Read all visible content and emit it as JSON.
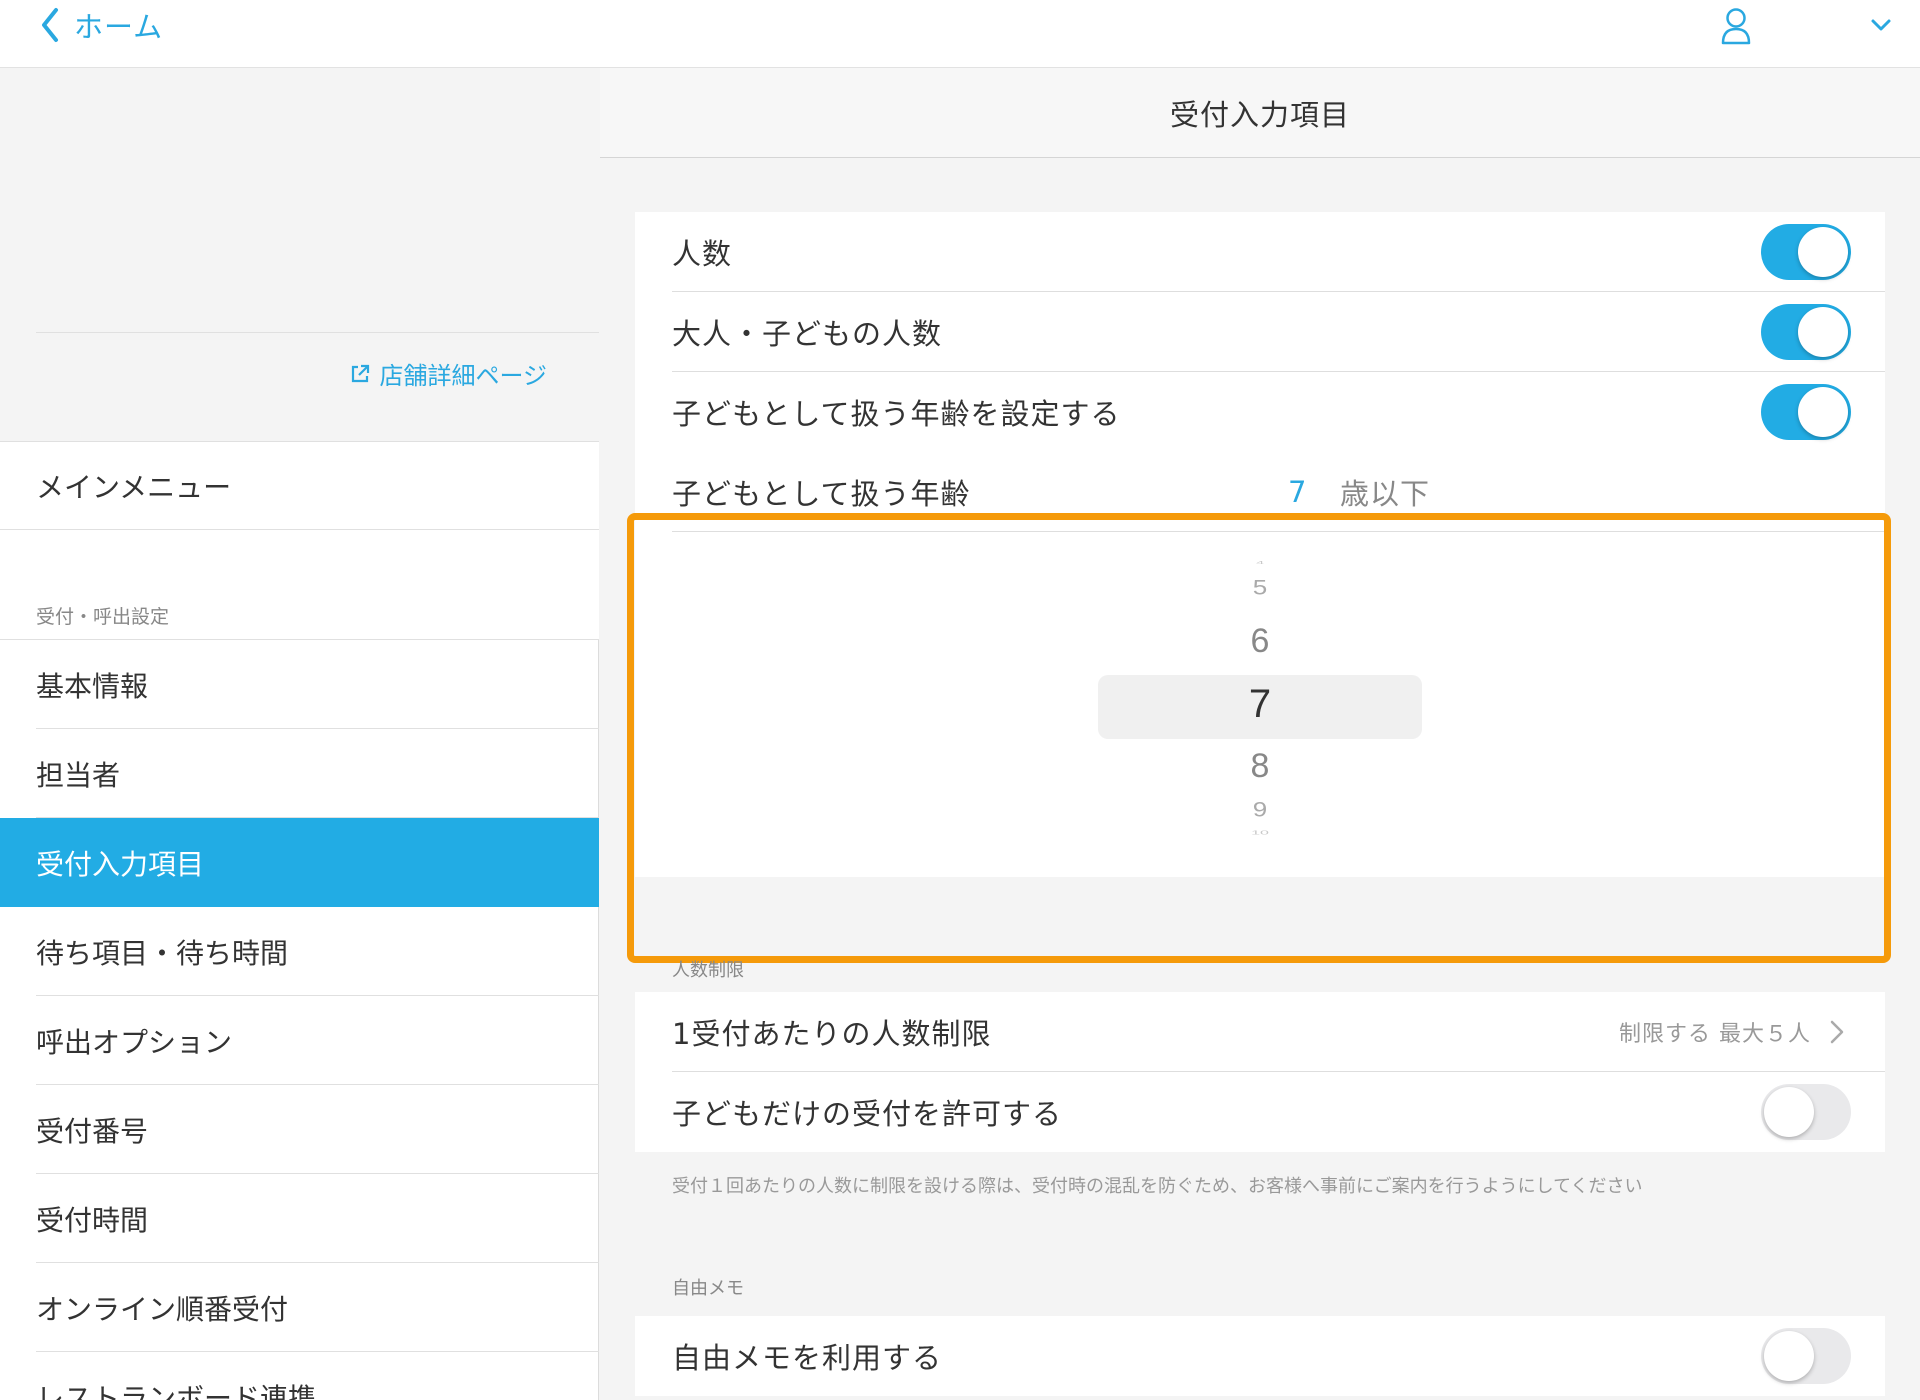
{
  "topbar": {
    "back_label": "ホーム",
    "back_icon": "chevron-left-icon",
    "user_icon": "user-icon",
    "dropdown_icon": "chevron-down-icon"
  },
  "sidebar": {
    "store_link_label": "店舗詳細ページ",
    "main_menu_label": "メインメニュー",
    "section_header": "受付・呼出設定",
    "items": [
      {
        "label": "基本情報",
        "active": false
      },
      {
        "label": "担当者",
        "active": false
      },
      {
        "label": "受付入力項目",
        "active": true
      },
      {
        "label": "待ち項目・待ち時間",
        "active": false
      },
      {
        "label": "呼出オプション",
        "active": false
      },
      {
        "label": "受付番号",
        "active": false
      },
      {
        "label": "受付時間",
        "active": false
      },
      {
        "label": "オンライン順番受付",
        "active": false
      },
      {
        "label": "レストランボード連携",
        "active": false
      }
    ]
  },
  "main": {
    "title": "受付入力項目",
    "settings": [
      {
        "label": "人数",
        "toggle": true
      },
      {
        "label": "大人・子どもの人数",
        "toggle": true
      },
      {
        "label": "子どもとして扱う年齢を設定する",
        "toggle": true
      }
    ],
    "age_picker": {
      "label": "子どもとして扱う年齢",
      "value": "7",
      "unit": "歳以下",
      "options": [
        "4",
        "5",
        "6",
        "7",
        "8",
        "9",
        "10"
      ],
      "selected": "7"
    },
    "limit_section": {
      "header": "人数制限",
      "per_reception_label": "1受付あたりの人数制限",
      "per_reception_value": "制限する 最大５人",
      "children_only_label": "子どもだけの受付を許可する",
      "children_only_toggle": false,
      "note": "受付１回あたりの人数に制限を設ける際は、受付時の混乱を防ぐため、お客様へ事前にご案内を行うようにしてください"
    },
    "memo_section": {
      "header": "自由メモ",
      "use_memo_label": "自由メモを利用する",
      "use_memo_toggle": false
    }
  },
  "colors": {
    "accent": "#22ace4",
    "link": "#2aa8e0",
    "highlight": "#f59a0a"
  }
}
